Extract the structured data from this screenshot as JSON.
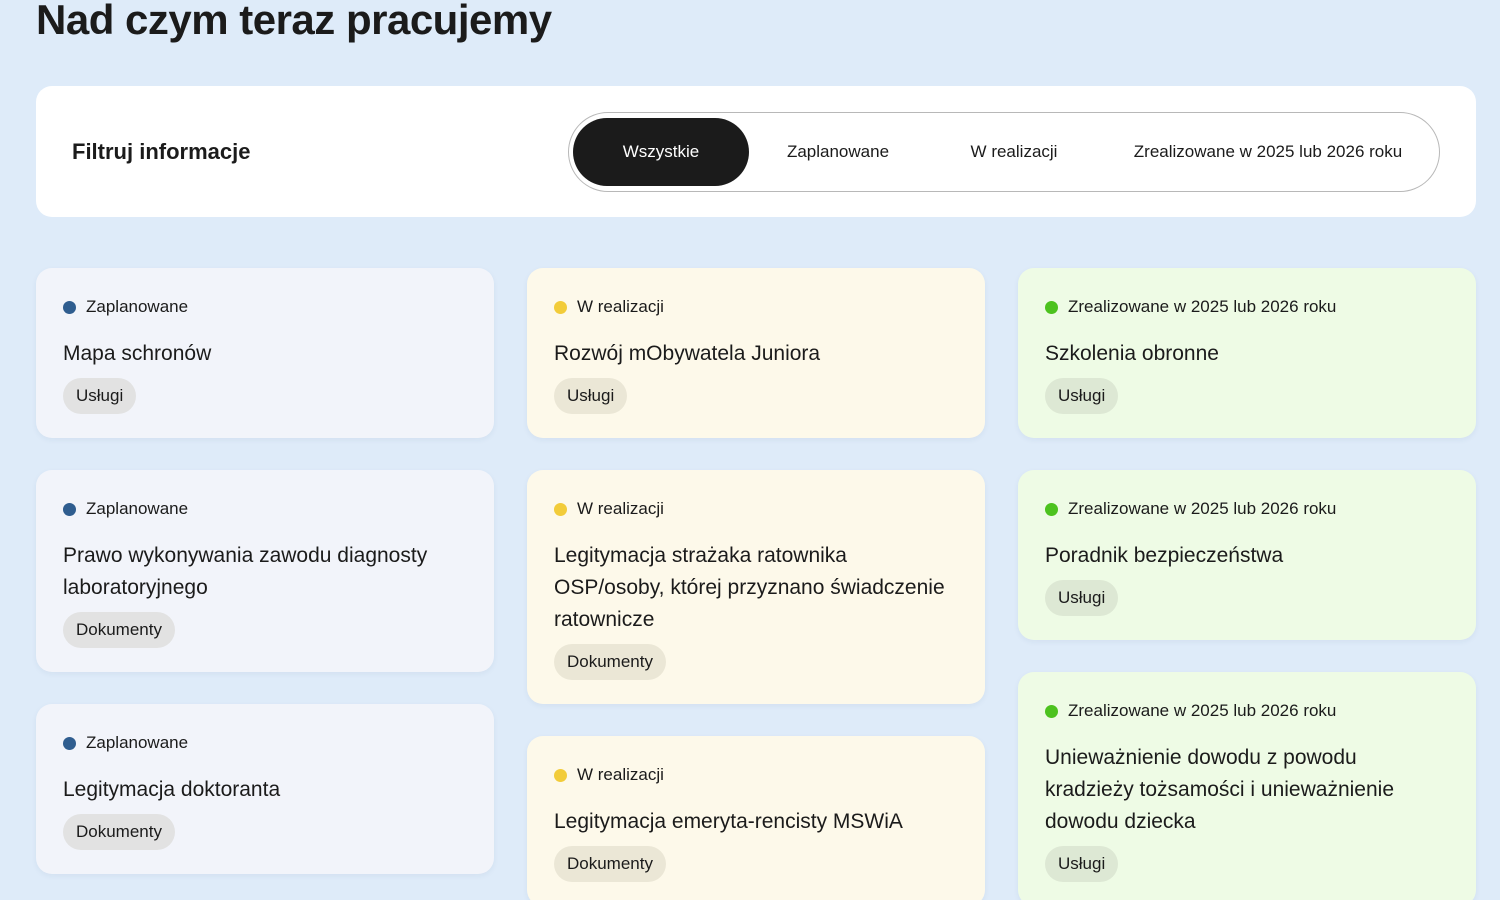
{
  "page": {
    "title": "Nad czym teraz pracujemy"
  },
  "filter": {
    "label": "Filtruj informacje",
    "options": [
      {
        "label": "Wszystkie",
        "active": true
      },
      {
        "label": "Zaplanowane",
        "active": false
      },
      {
        "label": "W realizacji",
        "active": false
      },
      {
        "label": "Zrealizowane w 2025 lub 2026 roku",
        "active": false
      }
    ]
  },
  "colors": {
    "planned_dot": "#2f5d8f",
    "progress_dot": "#f2cc3a",
    "done_dot": "#4cc21e"
  },
  "columns": [
    {
      "cards": [
        {
          "status": "Zaplanowane",
          "title": "Mapa schronów",
          "tag": "Usługi"
        },
        {
          "status": "Zaplanowane",
          "title": "Prawo wykonywania zawodu diagnosty laboratoryjnego",
          "tag": "Dokumenty"
        },
        {
          "status": "Zaplanowane",
          "title": "Legitymacja doktoranta",
          "tag": "Dokumenty"
        }
      ]
    },
    {
      "cards": [
        {
          "status": "W realizacji",
          "title": "Rozwój mObywatela Juniora",
          "tag": "Usługi"
        },
        {
          "status": "W realizacji",
          "title": "Legitymacja strażaka ratownika OSP/osoby, której przyznano świadczenie ratownicze",
          "tag": "Dokumenty"
        },
        {
          "status": "W realizacji",
          "title": "Legitymacja emeryta-rencisty MSWiA",
          "tag": "Dokumenty"
        }
      ]
    },
    {
      "cards": [
        {
          "status": "Zrealizowane w 2025 lub 2026 roku",
          "title": "Szkolenia obronne",
          "tag": "Usługi"
        },
        {
          "status": "Zrealizowane w 2025 lub 2026 roku",
          "title": "Poradnik bezpieczeństwa",
          "tag": "Usługi"
        },
        {
          "status": "Zrealizowane w 2025 lub 2026 roku",
          "title": "Unieważnienie dowodu z powodu kradzieży tożsamości i unieważnienie dowodu dziecka",
          "tag": "Usługi"
        }
      ]
    }
  ]
}
